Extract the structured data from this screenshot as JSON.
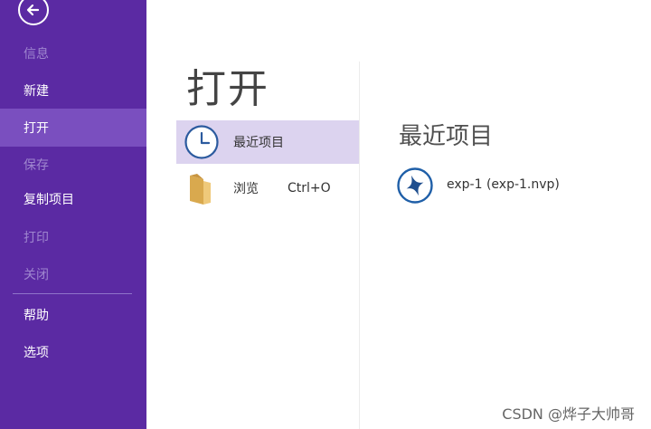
{
  "sidebar": {
    "back_icon": "arrow-left-circle-icon",
    "items": [
      {
        "label": "信息",
        "state": "disabled"
      },
      {
        "label": "新建",
        "state": "normal"
      },
      {
        "label": "打开",
        "state": "active"
      },
      {
        "label": "保存",
        "state": "disabled"
      },
      {
        "label": "复制项目",
        "state": "normal"
      },
      {
        "label": "打印",
        "state": "disabled"
      },
      {
        "label": "关闭",
        "state": "disabled"
      },
      {
        "label": "帮助",
        "state": "normal"
      },
      {
        "label": "选项",
        "state": "normal"
      }
    ],
    "colors": {
      "background": "#5b2aa3",
      "active": "#7a4fbf",
      "disabled_text": "#9f86cf"
    }
  },
  "main": {
    "heading": "打开",
    "options": [
      {
        "label": "最近项目",
        "icon": "clock-icon",
        "shortcut": "",
        "selected": true
      },
      {
        "label": "浏览",
        "icon": "folder-icon",
        "shortcut": "Ctrl+O",
        "selected": false
      }
    ]
  },
  "recent": {
    "title": "最近项目",
    "items": [
      {
        "label": "exp-1 (exp-1.nvp)",
        "icon": "project-star-icon"
      }
    ]
  },
  "watermark": "CSDN @烨子大帅哥"
}
